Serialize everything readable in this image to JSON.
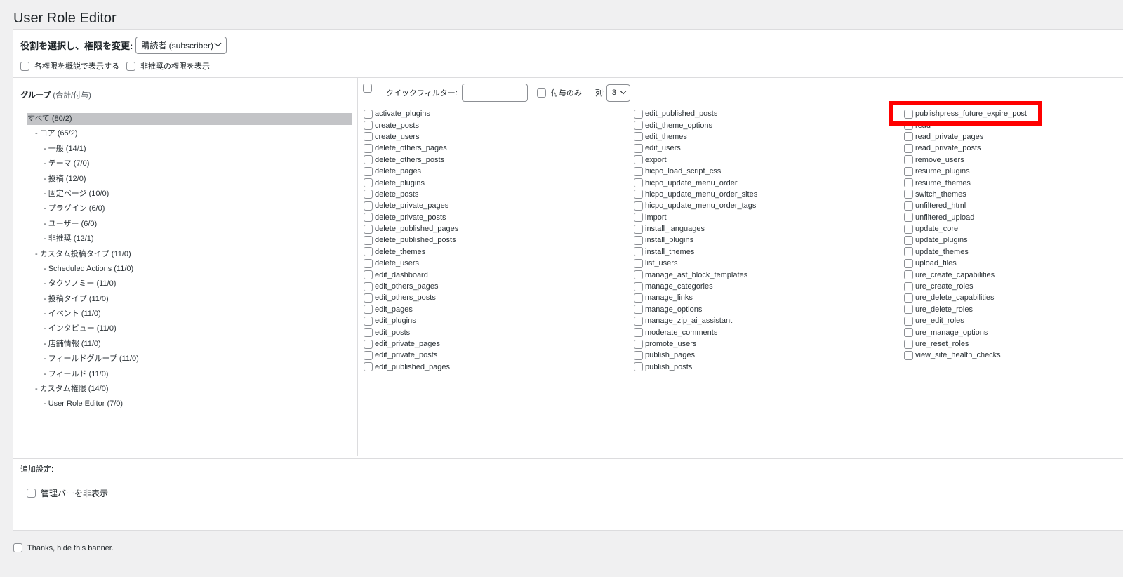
{
  "title": "User Role Editor",
  "role_selector": {
    "label": "役割を選択し、権限を変更:",
    "selected": "購読者 (subscriber)"
  },
  "options": {
    "show_human_readable": "各権限を概説で表示する",
    "show_deprecated": "非推奨の権限を表示"
  },
  "groups": {
    "header": "グループ",
    "header_sub": "(合計/付与)",
    "items": [
      "すべて (80/2)",
      "- コア (65/2)",
      "- 一般 (14/1)",
      "- テーマ (7/0)",
      "- 投稿 (12/0)",
      "- 固定ページ (10/0)",
      "- プラグイン (6/0)",
      "- ユーザー (6/0)",
      "- 非推奨 (12/1)",
      "- カスタム投稿タイプ (11/0)",
      "- Scheduled Actions (11/0)",
      "- タクソノミー (11/0)",
      "- 投稿タイプ (11/0)",
      "- イベント (11/0)",
      "- インタビュー (11/0)",
      "- 店舗情報 (11/0)",
      "- フィールドグループ (11/0)",
      "- フィールド (11/0)",
      "- カスタム権限 (14/0)",
      "- User Role Editor (7/0)"
    ]
  },
  "filter": {
    "quick_filter_label": "クイックフィルター:",
    "quick_filter_value": "",
    "granted_only_label": "付与のみ",
    "columns_label": "列:",
    "columns_value": "3"
  },
  "capabilities": {
    "col1": [
      "activate_plugins",
      "create_posts",
      "create_users",
      "delete_others_pages",
      "delete_others_posts",
      "delete_pages",
      "delete_plugins",
      "delete_posts",
      "delete_private_pages",
      "delete_private_posts",
      "delete_published_pages",
      "delete_published_posts",
      "delete_themes",
      "delete_users",
      "edit_dashboard",
      "edit_others_pages",
      "edit_others_posts",
      "edit_pages",
      "edit_plugins",
      "edit_posts",
      "edit_private_pages",
      "edit_private_posts",
      "edit_published_pages"
    ],
    "col2": [
      "edit_published_posts",
      "edit_theme_options",
      "edit_themes",
      "edit_users",
      "export",
      "hicpo_load_script_css",
      "hicpo_update_menu_order",
      "hicpo_update_menu_order_sites",
      "hicpo_update_menu_order_tags",
      "import",
      "install_languages",
      "install_plugins",
      "install_themes",
      "list_users",
      "manage_ast_block_templates",
      "manage_categories",
      "manage_links",
      "manage_options",
      "manage_zip_ai_assistant",
      "moderate_comments",
      "promote_users",
      "publish_pages",
      "publish_posts"
    ],
    "col3": [
      "publishpress_future_expire_post",
      "read",
      "read_private_pages",
      "read_private_posts",
      "remove_users",
      "resume_plugins",
      "resume_themes",
      "switch_themes",
      "unfiltered_html",
      "unfiltered_upload",
      "update_core",
      "update_plugins",
      "update_themes",
      "upload_files",
      "ure_create_capabilities",
      "ure_create_roles",
      "ure_delete_capabilities",
      "ure_delete_roles",
      "ure_edit_roles",
      "ure_manage_options",
      "ure_reset_roles",
      "view_site_health_checks"
    ]
  },
  "extra": {
    "label": "追加設定:",
    "hide_admin_bar": "管理バーを非表示"
  },
  "banner": {
    "hide_label": "Thanks, hide this banner."
  },
  "colors": {
    "highlight": "#ff0000",
    "selected_group_bg": "#c3c4c7"
  }
}
